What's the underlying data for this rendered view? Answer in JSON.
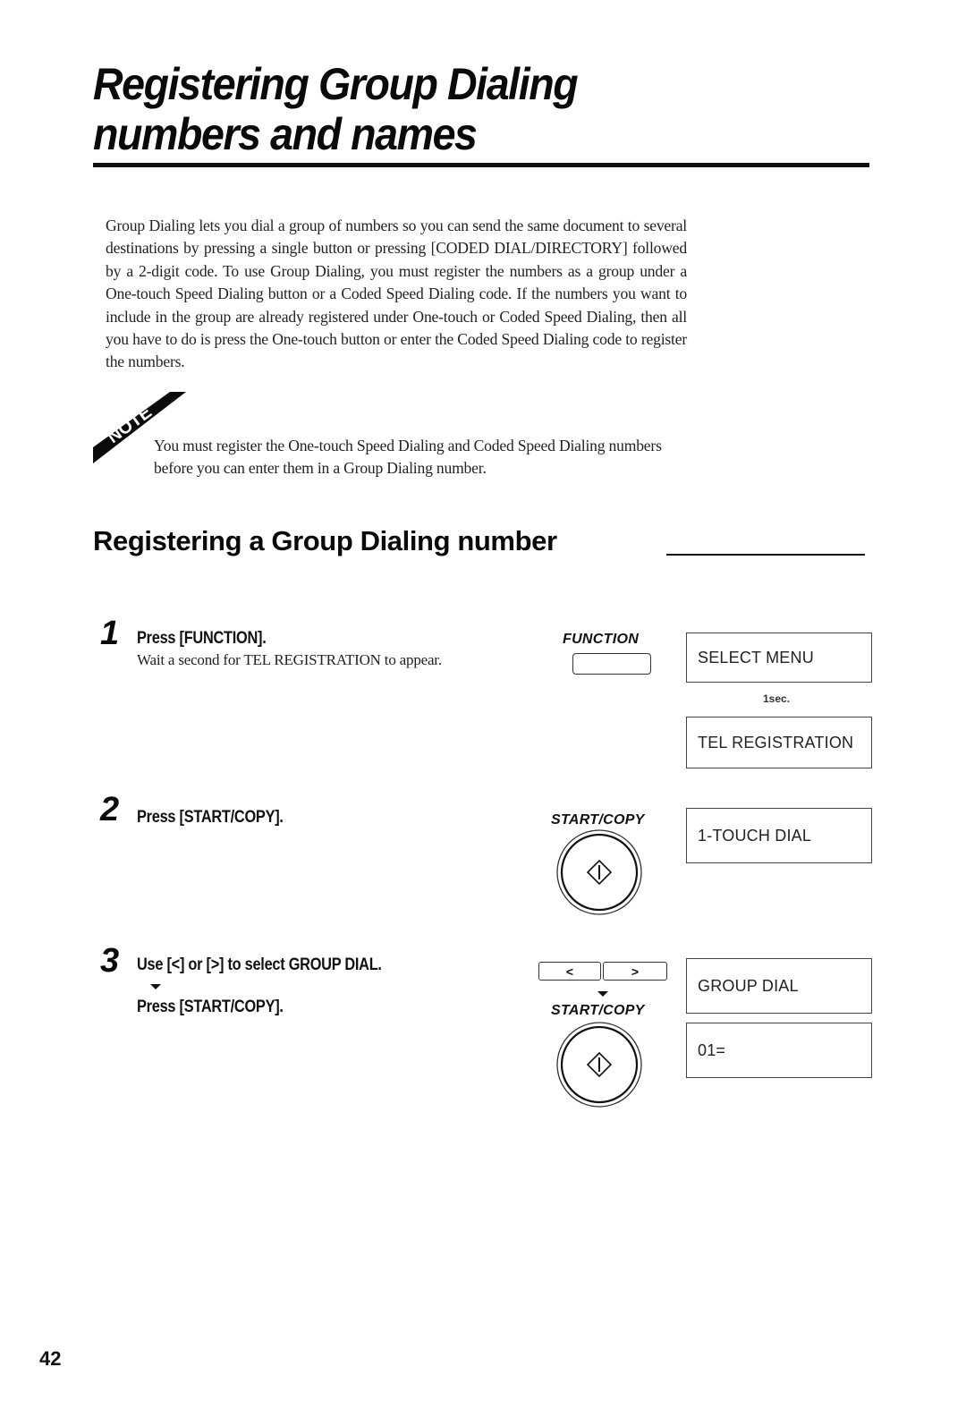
{
  "page": {
    "title": "Registering Group Dialing numbers and names",
    "title_lines": [
      "Registering Group Dialing",
      "numbers and names"
    ],
    "intro": "Group Dialing lets you dial a group of numbers so you can send the same document to several destinations by pressing a single button or pressing [CODED DIAL/DIRECTORY] followed by a 2-digit code. To use Group Dialing, you must register the numbers as a group under a One-touch Speed Dialing button or a Coded Speed Dialing code. If the numbers you want to include in the group are already registered under One-touch or Coded Speed Dialing, then all you have to do is press the One-touch button or enter the Coded Speed Dialing code to register the numbers.",
    "note": {
      "badge": "NOTE",
      "text": "You must register the One-touch Speed Dialing and Coded Speed Dialing numbers before you can enter them in a Group Dialing number."
    },
    "section_title": "Registering a Group Dialing number",
    "page_number": "42"
  },
  "steps": [
    {
      "number": "1",
      "heading": "Press [FUNCTION].",
      "detail": "Wait a second for TEL REGISTRATION to appear.",
      "key_label": "FUNCTION",
      "displays": [
        "SELECT MENU",
        "TEL REGISTRATION"
      ],
      "delay_label": "1sec."
    },
    {
      "number": "2",
      "heading": "Press [START/COPY].",
      "key_label": "START/COPY",
      "displays": [
        "1-TOUCH DIAL"
      ]
    },
    {
      "number": "3",
      "heading": "Use [<] or [>] to select GROUP DIAL.",
      "heading2": "Press [START/COPY].",
      "arrow_keys": [
        "<",
        ">"
      ],
      "key_label": "START/COPY",
      "displays": [
        "GROUP DIAL",
        "01="
      ]
    }
  ]
}
